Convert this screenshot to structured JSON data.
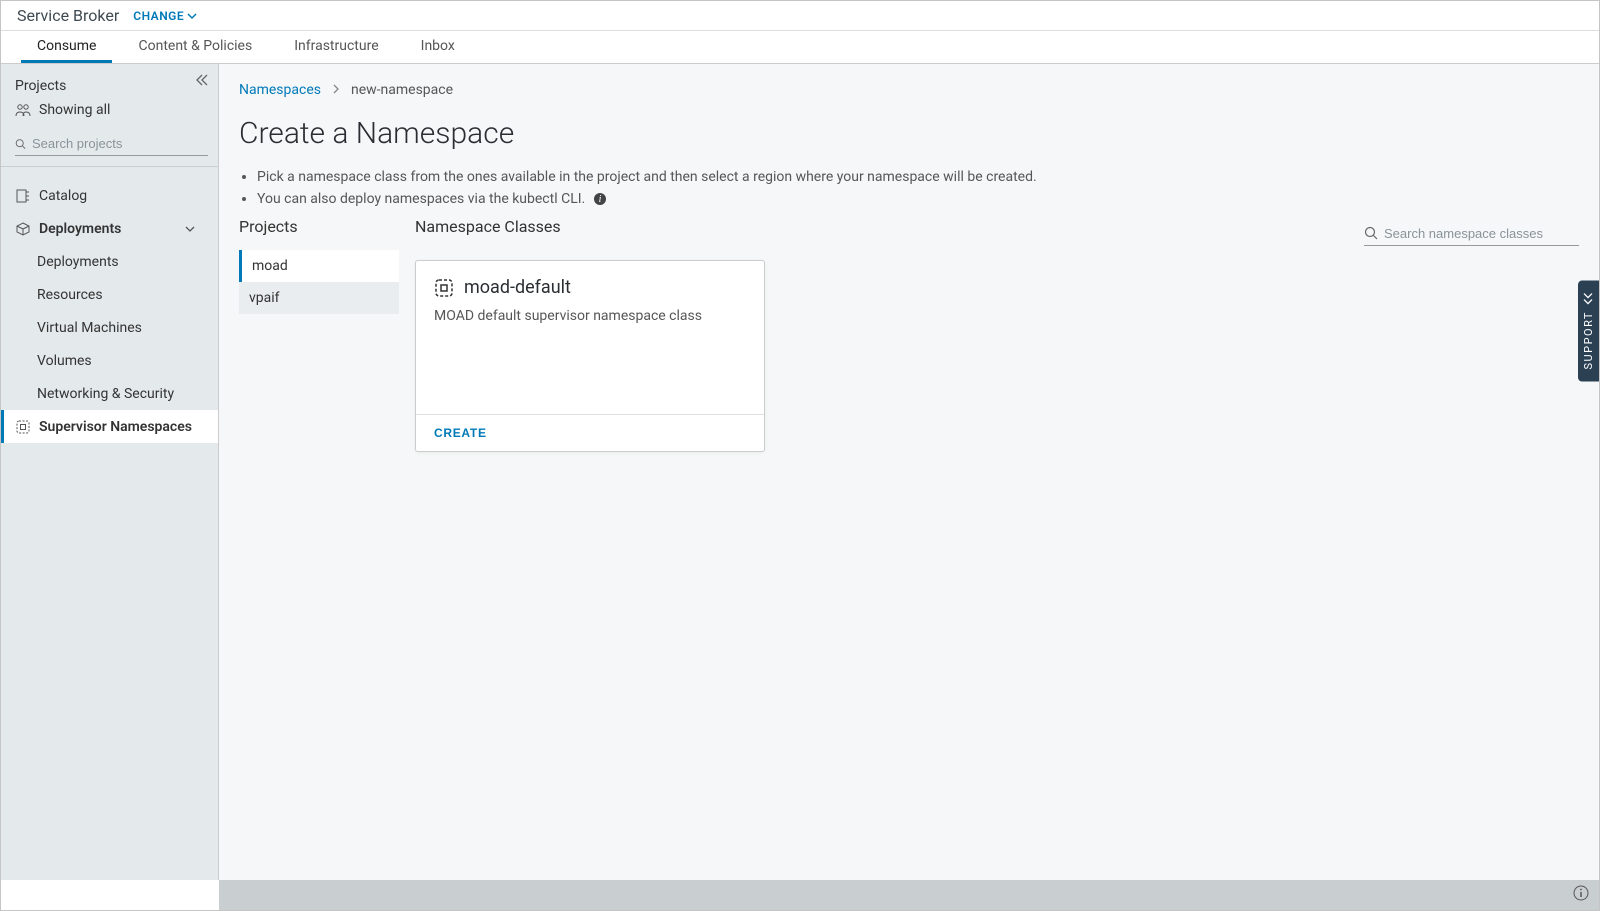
{
  "header": {
    "app_title": "Service Broker",
    "change_label": "CHANGE"
  },
  "tabs": [
    {
      "label": "Consume",
      "active": true
    },
    {
      "label": "Content & Policies",
      "active": false
    },
    {
      "label": "Infrastructure",
      "active": false
    },
    {
      "label": "Inbox",
      "active": false
    }
  ],
  "sidebar": {
    "projects_header": "Projects",
    "showing_all": "Showing all",
    "search_placeholder": "Search projects",
    "nav": {
      "catalog": "Catalog",
      "deployments": "Deployments",
      "sub": {
        "deployments": "Deployments",
        "resources": "Resources",
        "vms": "Virtual Machines",
        "volumes": "Volumes",
        "networking": "Networking & Security"
      },
      "supervisor": "Supervisor Namespaces"
    }
  },
  "breadcrumb": {
    "root": "Namespaces",
    "current": "new-namespace"
  },
  "page_title": "Create a Namespace",
  "instructions": {
    "line1": "Pick a namespace class from the ones available in the project and then select a region where your namespace will be created.",
    "line2": "You can also deploy namespaces via the kubectl CLI."
  },
  "projects_col": {
    "heading": "Projects",
    "items": [
      {
        "label": "moad",
        "active": true
      },
      {
        "label": "vpaif",
        "active": false
      }
    ]
  },
  "classes_col": {
    "heading": "Namespace Classes",
    "search_placeholder": "Search namespace classes"
  },
  "card": {
    "title": "moad-default",
    "desc": "MOAD default supervisor namespace class",
    "create_label": "CREATE"
  },
  "support_label": "SUPPORT"
}
